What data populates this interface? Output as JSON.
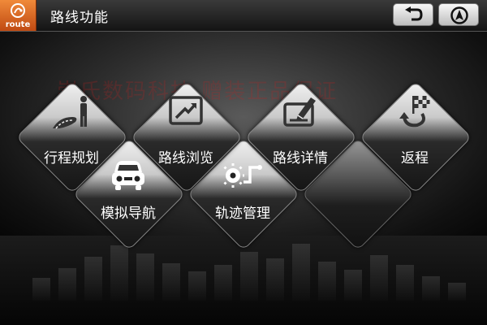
{
  "header": {
    "logo_text": "route",
    "title": "路线功能"
  },
  "watermark": "崇氏数码科技 赠装正品保证",
  "tiles": {
    "row1": [
      {
        "label": "行程规划",
        "icon": "route-plan-icon"
      },
      {
        "label": "路线浏览",
        "icon": "route-browse-icon"
      },
      {
        "label": "路线详情",
        "icon": "route-details-icon"
      },
      {
        "label": "返程",
        "icon": "return-trip-icon"
      }
    ],
    "row2": [
      {
        "label": "模拟导航",
        "icon": "car-icon"
      },
      {
        "label": "轨迹管理",
        "icon": "track-management-icon"
      }
    ]
  },
  "colors": {
    "accent": "#e8762e",
    "text": "#ffffff"
  }
}
